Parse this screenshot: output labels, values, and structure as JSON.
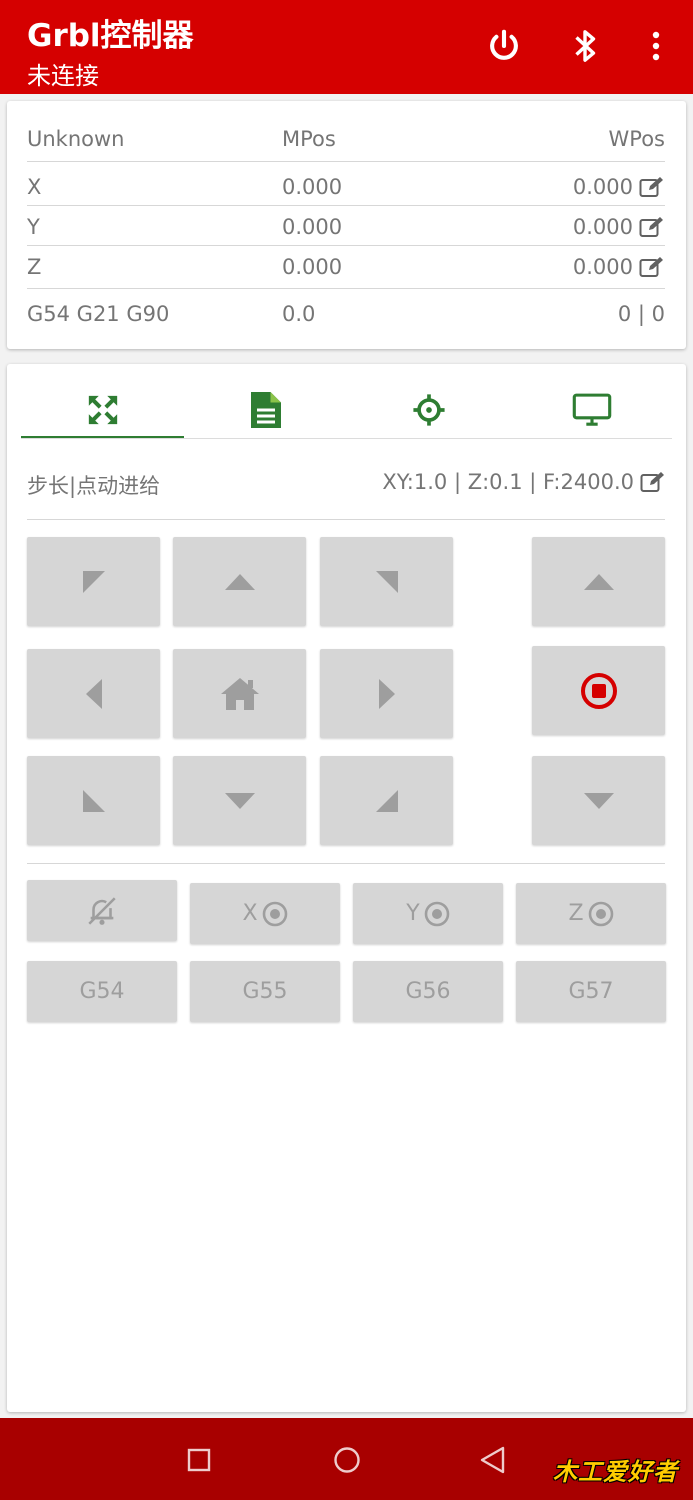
{
  "appbar": {
    "title": "Grbl控制器",
    "subtitle": "未连接",
    "icons": [
      "power-icon",
      "bluetooth-icon",
      "more-vert-icon"
    ],
    "color": "#d50000"
  },
  "position": {
    "headers": {
      "state": "Unknown",
      "mpos": "MPos",
      "wpos": "WPos"
    },
    "axes": [
      {
        "axis": "X",
        "mpos": "0.000",
        "wpos": "0.000"
      },
      {
        "axis": "Y",
        "mpos": "0.000",
        "wpos": "0.000"
      },
      {
        "axis": "Z",
        "mpos": "0.000",
        "wpos": "0.000"
      }
    ],
    "footer": {
      "modes": "G54 G21 G90",
      "feed": "0.0",
      "buffer": "0 | 0"
    }
  },
  "tabs": [
    "move-icon",
    "file-icon",
    "crosshair-icon",
    "monitor-icon"
  ],
  "step": {
    "label": "步长|点动进给",
    "value": "XY:1.0 | Z:0.1 | F:2400.0"
  },
  "jog": {
    "stop_color": "#d50000"
  },
  "actions": {
    "alarm_icon": "bell-off-icon",
    "zero_x": "X",
    "zero_y": "Y",
    "zero_z": "Z"
  },
  "wcs": {
    "g54": "G54",
    "g55": "G55",
    "g56": "G56",
    "g57": "G57"
  },
  "accent": "#2e7d32",
  "watermark": "木工爱好者"
}
